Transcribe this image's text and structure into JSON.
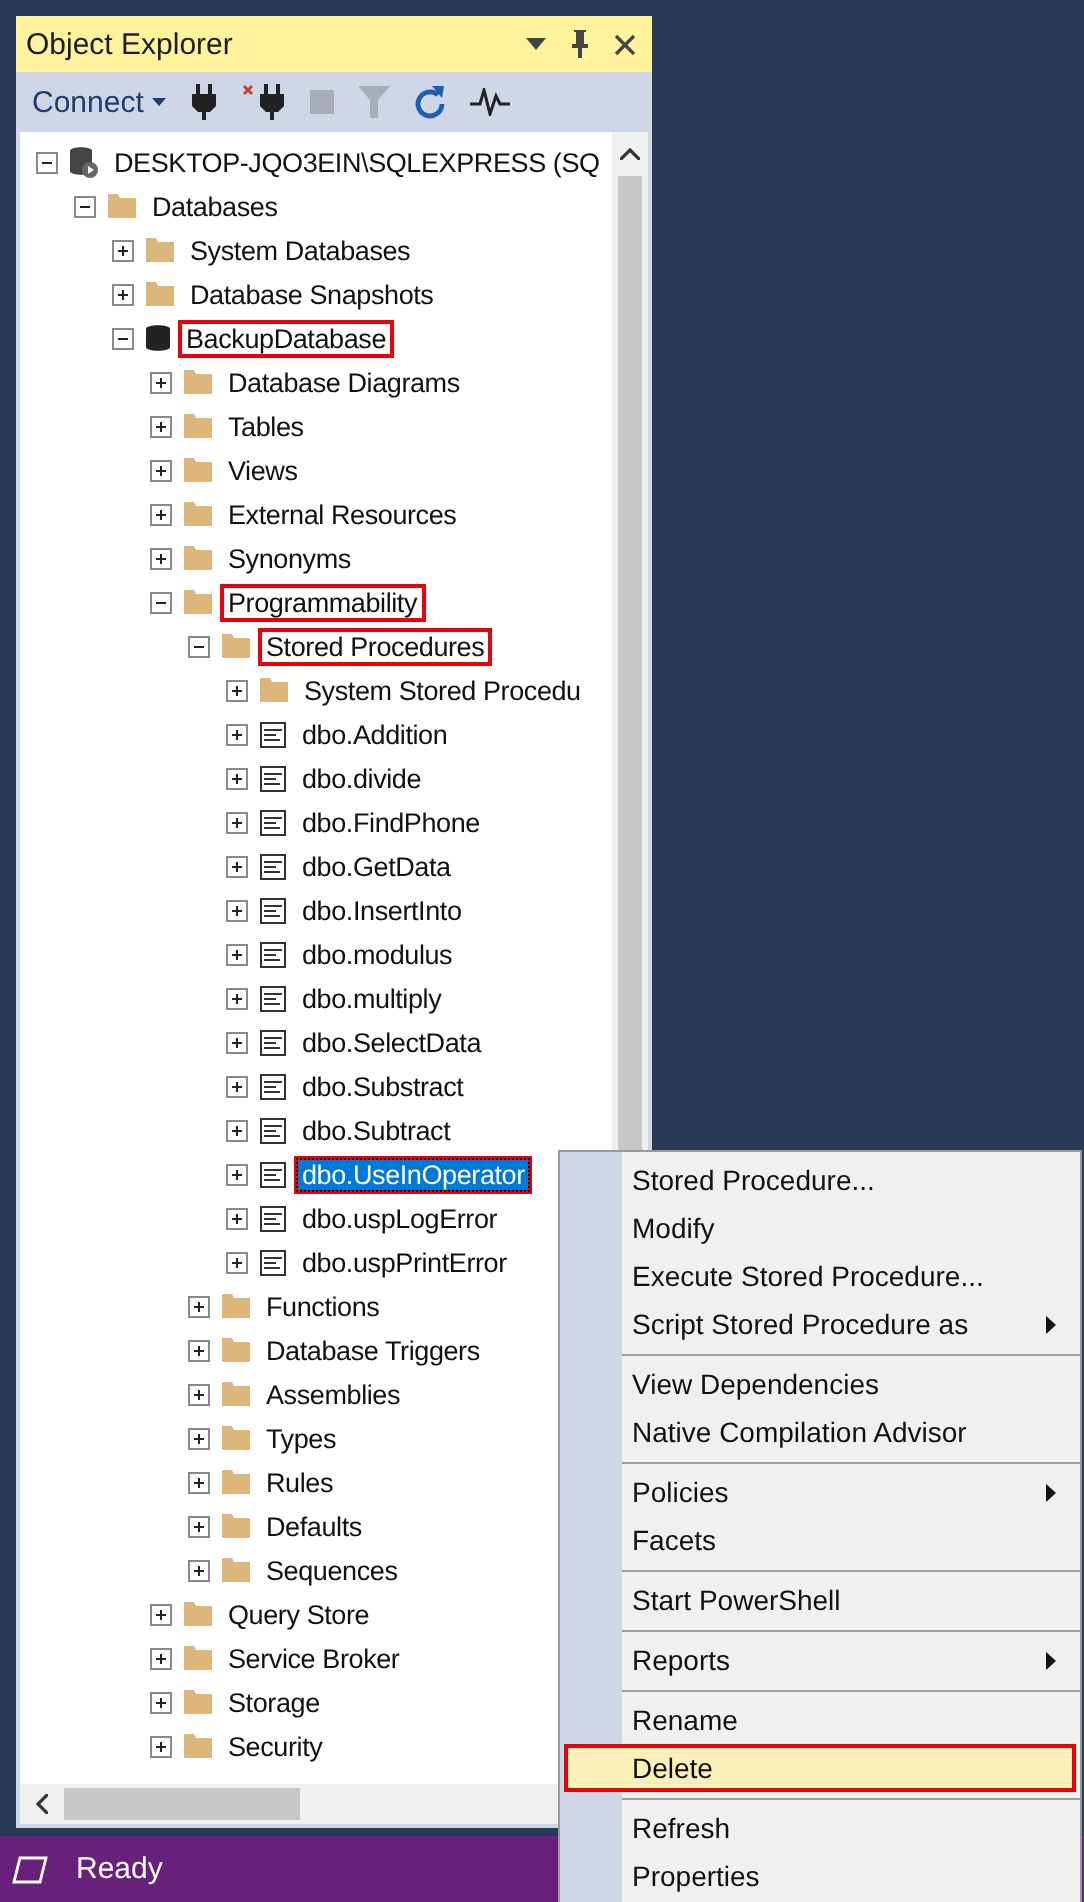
{
  "panel": {
    "title": "Object Explorer",
    "toolbar": {
      "connect": "Connect"
    }
  },
  "tree": [
    {
      "label": "DESKTOP-JQO3EIN\\SQLEXPRESS (SQ",
      "kind": "server",
      "expanded": true,
      "selected": false,
      "highlighted": false,
      "children": [
        {
          "label": "Databases",
          "kind": "folder",
          "expanded": true,
          "selected": false,
          "highlighted": false,
          "children": [
            {
              "label": "System Databases",
              "kind": "folder",
              "expanded": false,
              "selected": false,
              "highlighted": false
            },
            {
              "label": "Database Snapshots",
              "kind": "folder",
              "expanded": false,
              "selected": false,
              "highlighted": false
            },
            {
              "label": "BackupDatabase",
              "kind": "database",
              "expanded": true,
              "selected": false,
              "highlighted": true,
              "children": [
                {
                  "label": "Database Diagrams",
                  "kind": "folder",
                  "expanded": false,
                  "selected": false,
                  "highlighted": false
                },
                {
                  "label": "Tables",
                  "kind": "folder",
                  "expanded": false,
                  "selected": false,
                  "highlighted": false
                },
                {
                  "label": "Views",
                  "kind": "folder",
                  "expanded": false,
                  "selected": false,
                  "highlighted": false
                },
                {
                  "label": "External Resources",
                  "kind": "folder",
                  "expanded": false,
                  "selected": false,
                  "highlighted": false
                },
                {
                  "label": "Synonyms",
                  "kind": "folder",
                  "expanded": false,
                  "selected": false,
                  "highlighted": false
                },
                {
                  "label": "Programmability",
                  "kind": "folder",
                  "expanded": true,
                  "selected": false,
                  "highlighted": true,
                  "children": [
                    {
                      "label": "Stored Procedures",
                      "kind": "folder",
                      "expanded": true,
                      "selected": false,
                      "highlighted": true,
                      "children": [
                        {
                          "label": "System Stored Procedu",
                          "kind": "folder",
                          "expanded": false,
                          "selected": false,
                          "highlighted": false
                        },
                        {
                          "label": "dbo.Addition",
                          "kind": "procedure",
                          "expanded": false,
                          "selected": false,
                          "highlighted": false
                        },
                        {
                          "label": "dbo.divide",
                          "kind": "procedure",
                          "expanded": false,
                          "selected": false,
                          "highlighted": false
                        },
                        {
                          "label": "dbo.FindPhone",
                          "kind": "procedure",
                          "expanded": false,
                          "selected": false,
                          "highlighted": false
                        },
                        {
                          "label": "dbo.GetData",
                          "kind": "procedure",
                          "expanded": false,
                          "selected": false,
                          "highlighted": false
                        },
                        {
                          "label": "dbo.InsertInto",
                          "kind": "procedure",
                          "expanded": false,
                          "selected": false,
                          "highlighted": false
                        },
                        {
                          "label": "dbo.modulus",
                          "kind": "procedure",
                          "expanded": false,
                          "selected": false,
                          "highlighted": false
                        },
                        {
                          "label": "dbo.multiply",
                          "kind": "procedure",
                          "expanded": false,
                          "selected": false,
                          "highlighted": false
                        },
                        {
                          "label": "dbo.SelectData",
                          "kind": "procedure",
                          "expanded": false,
                          "selected": false,
                          "highlighted": false
                        },
                        {
                          "label": "dbo.Substract",
                          "kind": "procedure",
                          "expanded": false,
                          "selected": false,
                          "highlighted": false
                        },
                        {
                          "label": "dbo.Subtract",
                          "kind": "procedure",
                          "expanded": false,
                          "selected": false,
                          "highlighted": false
                        },
                        {
                          "label": "dbo.UseInOperator",
                          "kind": "procedure",
                          "expanded": false,
                          "selected": true,
                          "highlighted": true
                        },
                        {
                          "label": "dbo.uspLogError",
                          "kind": "procedure",
                          "expanded": false,
                          "selected": false,
                          "highlighted": false
                        },
                        {
                          "label": "dbo.uspPrintError",
                          "kind": "procedure",
                          "expanded": false,
                          "selected": false,
                          "highlighted": false
                        }
                      ]
                    },
                    {
                      "label": "Functions",
                      "kind": "folder",
                      "expanded": false,
                      "selected": false,
                      "highlighted": false
                    },
                    {
                      "label": "Database Triggers",
                      "kind": "folder",
                      "expanded": false,
                      "selected": false,
                      "highlighted": false
                    },
                    {
                      "label": "Assemblies",
                      "kind": "folder",
                      "expanded": false,
                      "selected": false,
                      "highlighted": false
                    },
                    {
                      "label": "Types",
                      "kind": "folder",
                      "expanded": false,
                      "selected": false,
                      "highlighted": false
                    },
                    {
                      "label": "Rules",
                      "kind": "folder",
                      "expanded": false,
                      "selected": false,
                      "highlighted": false
                    },
                    {
                      "label": "Defaults",
                      "kind": "folder",
                      "expanded": false,
                      "selected": false,
                      "highlighted": false
                    },
                    {
                      "label": "Sequences",
                      "kind": "folder",
                      "expanded": false,
                      "selected": false,
                      "highlighted": false
                    }
                  ]
                },
                {
                  "label": "Query Store",
                  "kind": "folder",
                  "expanded": false,
                  "selected": false,
                  "highlighted": false
                },
                {
                  "label": "Service Broker",
                  "kind": "folder",
                  "expanded": false,
                  "selected": false,
                  "highlighted": false
                },
                {
                  "label": "Storage",
                  "kind": "folder",
                  "expanded": false,
                  "selected": false,
                  "highlighted": false
                },
                {
                  "label": "Security",
                  "kind": "folder",
                  "expanded": false,
                  "selected": false,
                  "highlighted": false
                }
              ]
            }
          ]
        }
      ]
    }
  ],
  "context_menu": [
    {
      "kind": "item",
      "label": "Stored Procedure...",
      "submenu": false,
      "highlighted": false
    },
    {
      "kind": "item",
      "label": "Modify",
      "submenu": false,
      "highlighted": false
    },
    {
      "kind": "item",
      "label": "Execute Stored Procedure...",
      "submenu": false,
      "highlighted": false
    },
    {
      "kind": "item",
      "label": "Script Stored Procedure as",
      "submenu": true,
      "highlighted": false
    },
    {
      "kind": "separator"
    },
    {
      "kind": "item",
      "label": "View Dependencies",
      "submenu": false,
      "highlighted": false
    },
    {
      "kind": "item",
      "label": "Native Compilation Advisor",
      "submenu": false,
      "highlighted": false
    },
    {
      "kind": "separator"
    },
    {
      "kind": "item",
      "label": "Policies",
      "submenu": true,
      "highlighted": false
    },
    {
      "kind": "item",
      "label": "Facets",
      "submenu": false,
      "highlighted": false
    },
    {
      "kind": "separator"
    },
    {
      "kind": "item",
      "label": "Start PowerShell",
      "submenu": false,
      "highlighted": false
    },
    {
      "kind": "separator"
    },
    {
      "kind": "item",
      "label": "Reports",
      "submenu": true,
      "highlighted": false
    },
    {
      "kind": "separator"
    },
    {
      "kind": "item",
      "label": "Rename",
      "submenu": false,
      "highlighted": false
    },
    {
      "kind": "item",
      "label": "Delete",
      "submenu": false,
      "highlighted": true
    },
    {
      "kind": "separator"
    },
    {
      "kind": "item",
      "label": "Refresh",
      "submenu": false,
      "highlighted": false
    },
    {
      "kind": "item",
      "label": "Properties",
      "submenu": false,
      "highlighted": false
    }
  ],
  "status_bar": {
    "text": "Ready"
  }
}
